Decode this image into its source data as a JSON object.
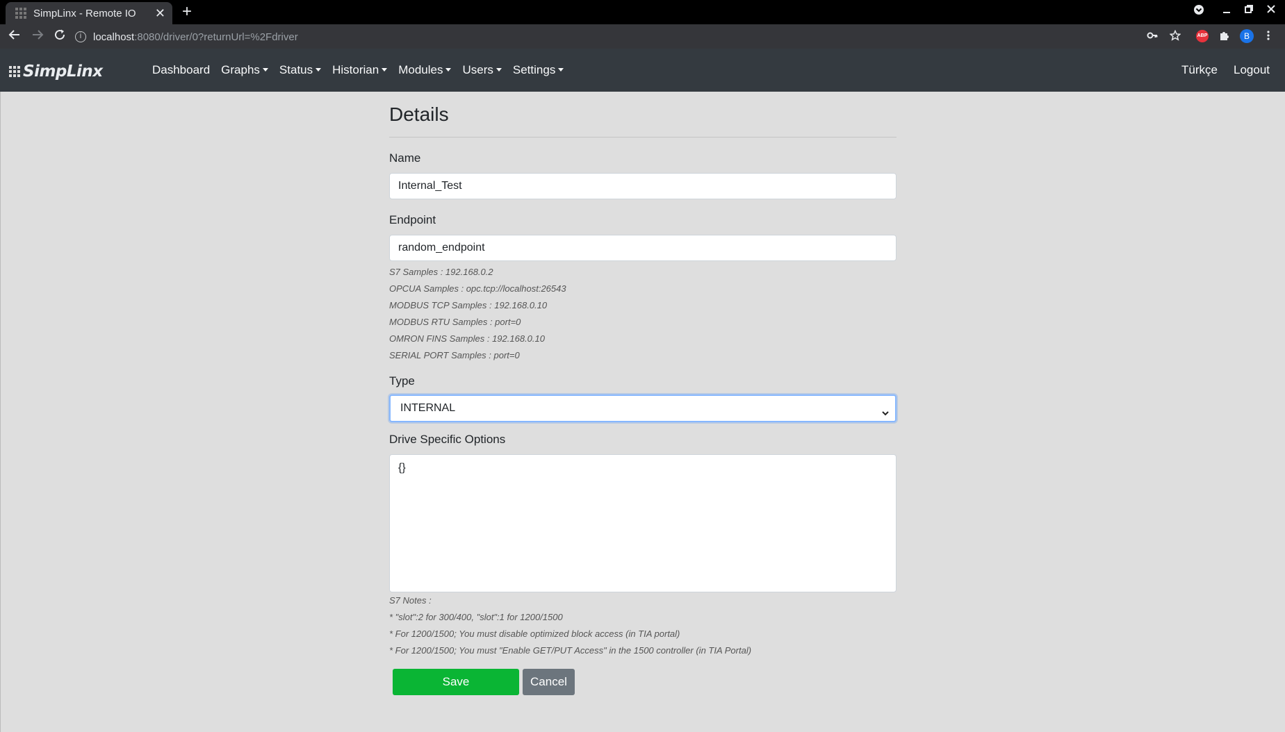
{
  "browser": {
    "tab_title": "SimpLinx - Remote IO",
    "tab_close": "✕",
    "new_tab": "+",
    "url_host": "localhost",
    "url_rest": ":8080/driver/0?returnUrl=%2Fdriver",
    "profile_initial": "B",
    "abp_label": "ABP"
  },
  "navbar": {
    "brand": "SimpLinx",
    "items": [
      {
        "label": "Dashboard",
        "dropdown": false
      },
      {
        "label": "Graphs",
        "dropdown": true
      },
      {
        "label": "Status",
        "dropdown": true
      },
      {
        "label": "Historian",
        "dropdown": true
      },
      {
        "label": "Modules",
        "dropdown": true
      },
      {
        "label": "Users",
        "dropdown": true
      },
      {
        "label": "Settings",
        "dropdown": true
      }
    ],
    "language": "Türkçe",
    "logout": "Logout"
  },
  "form": {
    "title": "Details",
    "name_label": "Name",
    "name_value": "Internal_Test",
    "endpoint_label": "Endpoint",
    "endpoint_value": "random_endpoint",
    "endpoint_hints": [
      "S7 Samples : 192.168.0.2",
      "OPCUA Samples : opc.tcp://localhost:26543",
      "MODBUS TCP Samples : 192.168.0.10",
      "MODBUS RTU Samples : port=0",
      "OMRON FINS Samples : 192.168.0.10",
      "SERIAL PORT Samples : port=0"
    ],
    "type_label": "Type",
    "type_value": "INTERNAL",
    "options_label": "Drive Specific Options",
    "options_value": "{}",
    "notes": [
      "S7 Notes :",
      "* \"slot\":2 for 300/400, \"slot\":1 for 1200/1500",
      "* For 1200/1500; You must disable optimized block access (in TIA portal)",
      "* For 1200/1500; You must \"Enable GET/PUT Access\" in the 1500 controller (in TIA Portal)"
    ],
    "save_label": "Save",
    "cancel_label": "Cancel"
  },
  "colors": {
    "navbar_bg": "#343a40",
    "page_bg": "#dedede",
    "save_button": "#0ab534",
    "cancel_button": "#6c757d",
    "focus_border": "#86b7fe"
  }
}
